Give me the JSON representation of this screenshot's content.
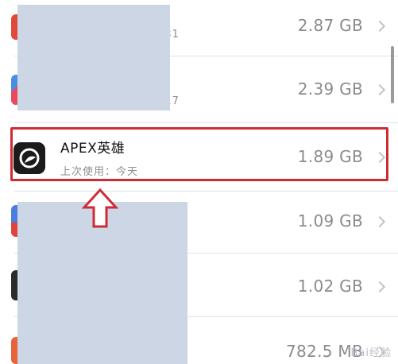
{
  "rows": [
    {
      "date_fragment": "/31",
      "size": "2.87 GB"
    },
    {
      "date_fragment": "/17",
      "size": "2.39 GB"
    },
    {
      "name": "APEX英雄",
      "subtitle": "上次使用：今天",
      "size": "1.89 GB"
    },
    {
      "size": "1.09 GB"
    },
    {
      "size": "1.02 GB"
    },
    {
      "size": "782.5 MB"
    }
  ],
  "colors": {
    "highlight": "#cf2b36",
    "redaction": "#cdd6e4",
    "secondary_text": "#8a8a8f"
  },
  "icons": {
    "apex": "apex-legends-app-icon",
    "chevron": "chevron-right-icon",
    "arrow": "red-up-arrow-annotation"
  },
  "watermark": "Bai经验"
}
